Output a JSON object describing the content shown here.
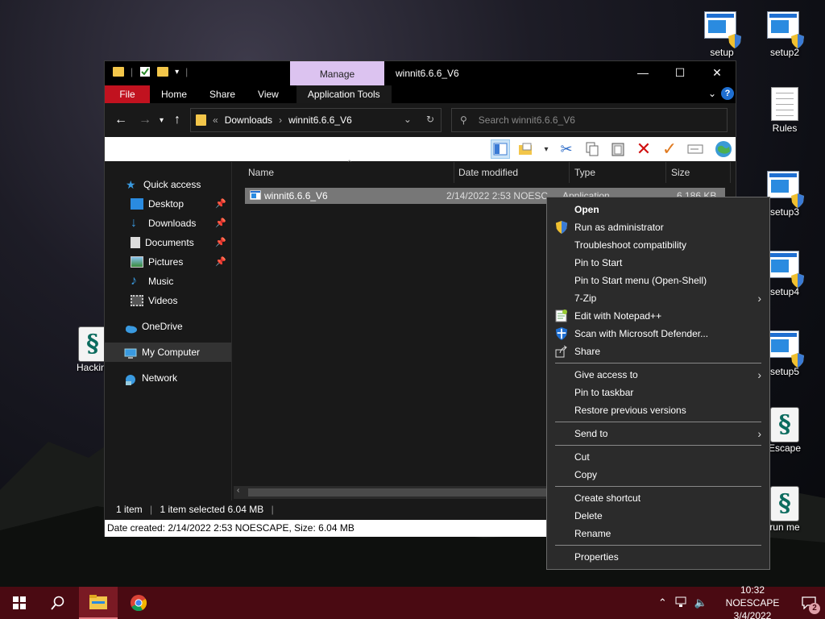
{
  "desktop": {
    "icons_right": [
      {
        "label": "setup"
      },
      {
        "label": "setup2"
      },
      {
        "label": "Rules"
      },
      {
        "label": "setup3"
      },
      {
        "label": "setup4"
      },
      {
        "label": "setup5"
      },
      {
        "label": "Escape"
      },
      {
        "label": "run me"
      }
    ],
    "icon_left": {
      "label": "Hackin"
    }
  },
  "window": {
    "title": "winnit6.6.6_V6",
    "manage_label": "Manage",
    "ribbon_tabs": [
      "File",
      "Home",
      "Share",
      "View"
    ],
    "app_tools_label": "Application Tools",
    "address": {
      "crumb_prefix": "«",
      "crumb1": "Downloads",
      "crumb2": "winnit6.6.6_V6"
    },
    "search_placeholder": "Search winnit6.6.6_V6",
    "nav": {
      "quick_access": "Quick access",
      "desktop": "Desktop",
      "downloads": "Downloads",
      "documents": "Documents",
      "pictures": "Pictures",
      "music": "Music",
      "videos": "Videos",
      "onedrive": "OneDrive",
      "my_computer": "My Computer",
      "network": "Network"
    },
    "columns": {
      "name": "Name",
      "date": "Date modified",
      "type": "Type",
      "size": "Size"
    },
    "file": {
      "name": "winnit6.6.6_V6",
      "date": "2/14/2022 2:53 NOESC",
      "type": "Application",
      "size": "6,186 KB"
    },
    "status": {
      "items": "1 item",
      "selected": "1 item selected  6.04 MB"
    },
    "info": "Date created: 2/14/2022 2:53 NOESCAPE, Size: 6.04 MB"
  },
  "context_menu": {
    "open": "Open",
    "run_admin": "Run as administrator",
    "troubleshoot": "Troubleshoot compatibility",
    "pin_start": "Pin to Start",
    "pin_start_openshell": "Pin to Start menu (Open-Shell)",
    "zip": "7-Zip",
    "notepad": "Edit with Notepad++",
    "defender": "Scan with Microsoft Defender...",
    "share": "Share",
    "give_access": "Give access to",
    "pin_taskbar": "Pin to taskbar",
    "restore": "Restore previous versions",
    "send_to": "Send to",
    "cut": "Cut",
    "copy": "Copy",
    "create_shortcut": "Create shortcut",
    "delete": "Delete",
    "rename": "Rename",
    "properties": "Properties"
  },
  "taskbar": {
    "time": "10:32 NOESCAPE",
    "date": "3/4/2022",
    "notification_count": "2"
  },
  "colors": {
    "accent": "#c1121f",
    "taskbar": "#4a0a12",
    "manage_tab": "#dcc3f0"
  }
}
